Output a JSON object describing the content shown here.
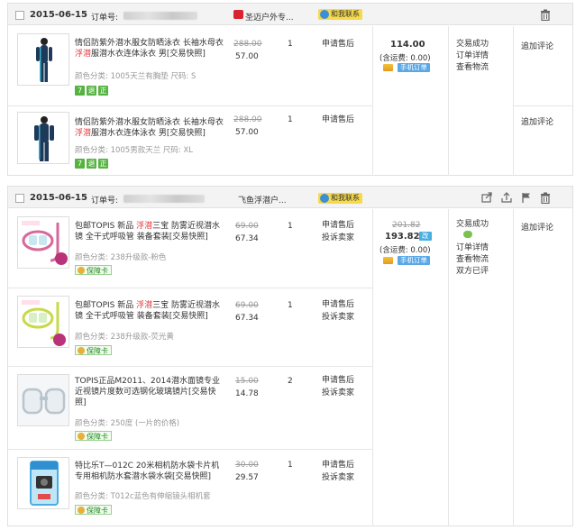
{
  "orders": [
    {
      "date": "2015-06-15",
      "order_no_label": "订单号:",
      "shop_name": "圣迈户外专...",
      "contact_label": "和我联系",
      "total": "114.00",
      "shipping": "(含运费: 0.00)",
      "mobile_label": "手机订单",
      "status": [
        "交易成功",
        "订单详情",
        "查看物流"
      ],
      "items": [
        {
          "title_pre": "情侣防紫外潜水服女防晒泳衣 长袖水母衣",
          "title_hl": "浮潜",
          "title_post": "服潜水衣连体泳衣 男[交易快照]",
          "attr": "颜色分类: 1005天兰有胸垫  尺码: S",
          "badges": [
            "7",
            "退",
            "正"
          ],
          "price_old": "288.00",
          "price_now": "57.00",
          "qty": "1",
          "action": [
            "申请售后"
          ],
          "review": "追加评论"
        },
        {
          "title_pre": "情侣防紫外潜水服女防晒泳衣 长袖水母衣",
          "title_hl": "浮潜",
          "title_post": "服潜水衣连体泳衣 男[交易快照]",
          "attr": "颜色分类: 1005男款天兰  尺码: XL",
          "badges": [
            "7",
            "退",
            "正"
          ],
          "price_old": "288.00",
          "price_now": "57.00",
          "qty": "1",
          "action": [
            "申请售后"
          ],
          "review": "追加评论"
        }
      ]
    },
    {
      "date": "2015-06-15",
      "order_no_label": "订单号:",
      "shop_name": "飞鱼浮潜户...",
      "contact_label": "和我联系",
      "total_old": "201.82",
      "total": "193.82",
      "total_tag": "改",
      "shipping": "(含运费: 0.00)",
      "mobile_label": "手机订单",
      "status": [
        "交易成功",
        "",
        "订单详情",
        "查看物流",
        "双方已评"
      ],
      "review": "追加评论",
      "items": [
        {
          "title_pre": "包邮TOPIS 新品 ",
          "title_hl": "浮潜",
          "title_post": "三宝 防雾近视潜水镜 全干式呼吸管 装备套装[交易快照]",
          "attr": "颜色分类: 238升级款-粉色",
          "card_label": "保障卡",
          "price_old": "69.00",
          "price_now": "67.34",
          "qty": "1",
          "action": [
            "申请售后",
            "投诉卖家"
          ]
        },
        {
          "title_pre": "包邮TOPIS 新品 ",
          "title_hl": "浮潜",
          "title_post": "三宝 防雾近视潜水镜 全干式呼吸管 装备套装[交易快照]",
          "attr": "颜色分类: 238升级款-荧光黄",
          "card_label": "保障卡",
          "price_old": "69.00",
          "price_now": "67.34",
          "qty": "1",
          "action": [
            "申请售后",
            "投诉卖家"
          ]
        },
        {
          "title_pre": "TOPIS正品M2011、2014潜水面镜专业近视镜片度数可选钢化玻璃镜片[交易快照]",
          "title_hl": "",
          "title_post": "",
          "attr": "颜色分类: 250度 (一片的价格)",
          "card_label": "保障卡",
          "price_old": "15.00",
          "price_now": "14.78",
          "qty": "2",
          "action": [
            "申请售后",
            "投诉卖家"
          ]
        },
        {
          "title_pre": "特比乐T—012C 20米相机防水袋卡片机专用相机防水套潜水袋水袋[交易快照]",
          "title_hl": "",
          "title_post": "",
          "attr": "颜色分类: T012c蓝色有伸缩镜头相机套",
          "card_label": "保障卡",
          "price_old": "30.00",
          "price_now": "29.57",
          "qty": "1",
          "action": [
            "申请售后",
            "投诉卖家"
          ]
        }
      ]
    }
  ]
}
